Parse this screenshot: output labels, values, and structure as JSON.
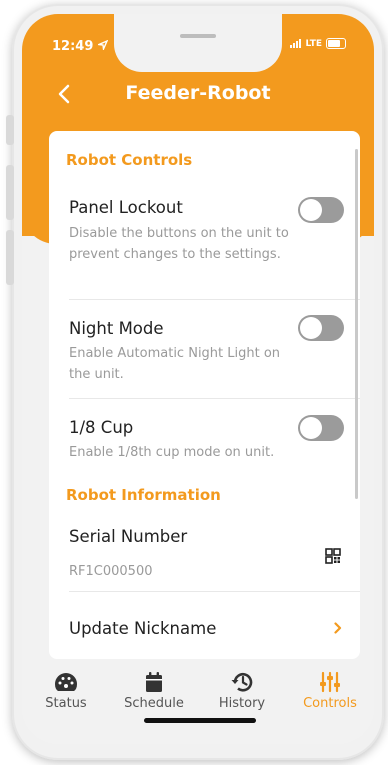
{
  "status_bar": {
    "time": "12:49",
    "network": "LTE"
  },
  "header": {
    "title": "Feeder-Robot",
    "back_icon": "chevron-left-icon"
  },
  "sections": {
    "controls_title": "Robot Controls",
    "info_title": "Robot Information"
  },
  "controls": [
    {
      "title": "Panel Lockout",
      "desc": "Disable the buttons on the unit to prevent changes to the settings.",
      "enabled": false
    },
    {
      "title": "Night Mode",
      "desc": "Enable Automatic Night Light on the unit.",
      "enabled": false
    },
    {
      "title": "1/8 Cup",
      "desc": "Enable 1/8th cup mode on unit.",
      "enabled": false
    }
  ],
  "info": {
    "serial_label": "Serial Number",
    "serial_value": "RF1C000500",
    "serial_icon": "qr-code-icon",
    "nickname_label": "Update Nickname",
    "nickname_icon": "chevron-right-icon"
  },
  "tabs": [
    {
      "label": "Status",
      "icon": "gauge-icon",
      "active": false
    },
    {
      "label": "Schedule",
      "icon": "calendar-icon",
      "active": false
    },
    {
      "label": "History",
      "icon": "history-icon",
      "active": false
    },
    {
      "label": "Controls",
      "icon": "sliders-icon",
      "active": true
    }
  ],
  "colors": {
    "accent": "#f39a1e",
    "toggle_off": "#9b9b9b"
  }
}
